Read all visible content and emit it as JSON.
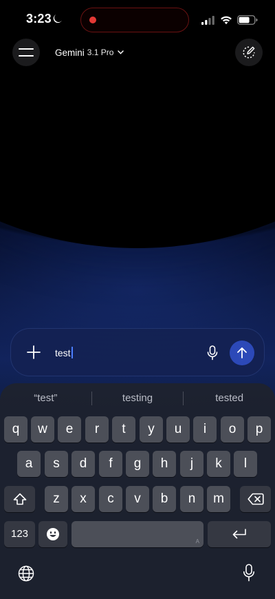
{
  "status_bar": {
    "time": "3:23",
    "icons": [
      "moon-icon",
      "signal-icon",
      "wifi-icon",
      "battery-icon"
    ],
    "recording_color": "#e53935"
  },
  "header": {
    "menu_icon": "hamburger-icon",
    "model_name": "Gemini",
    "model_version": "3.1 Pro",
    "chevron_icon": "chevron-down-icon",
    "new_chat_icon": "edit-icon"
  },
  "composer": {
    "add_icon": "plus-icon",
    "input_value": "test",
    "mic_icon": "mic-icon",
    "send_icon": "arrow-up-icon",
    "send_color": "#2c49b8"
  },
  "keyboard": {
    "suggestions": [
      "“test”",
      "testing",
      "tested"
    ],
    "row1": [
      "q",
      "w",
      "e",
      "r",
      "t",
      "y",
      "u",
      "i",
      "o",
      "p"
    ],
    "row2": [
      "a",
      "s",
      "d",
      "f",
      "g",
      "h",
      "j",
      "k",
      "l"
    ],
    "row3": [
      "z",
      "x",
      "c",
      "v",
      "b",
      "n",
      "m"
    ],
    "numbers_label": "123",
    "space_mark": "A",
    "shift_icon": "shift-icon",
    "backspace_icon": "backspace-icon",
    "emoji_icon": "emoji-icon",
    "return_icon": "return-icon",
    "globe_icon": "globe-icon",
    "dictation_icon": "mic-icon"
  }
}
